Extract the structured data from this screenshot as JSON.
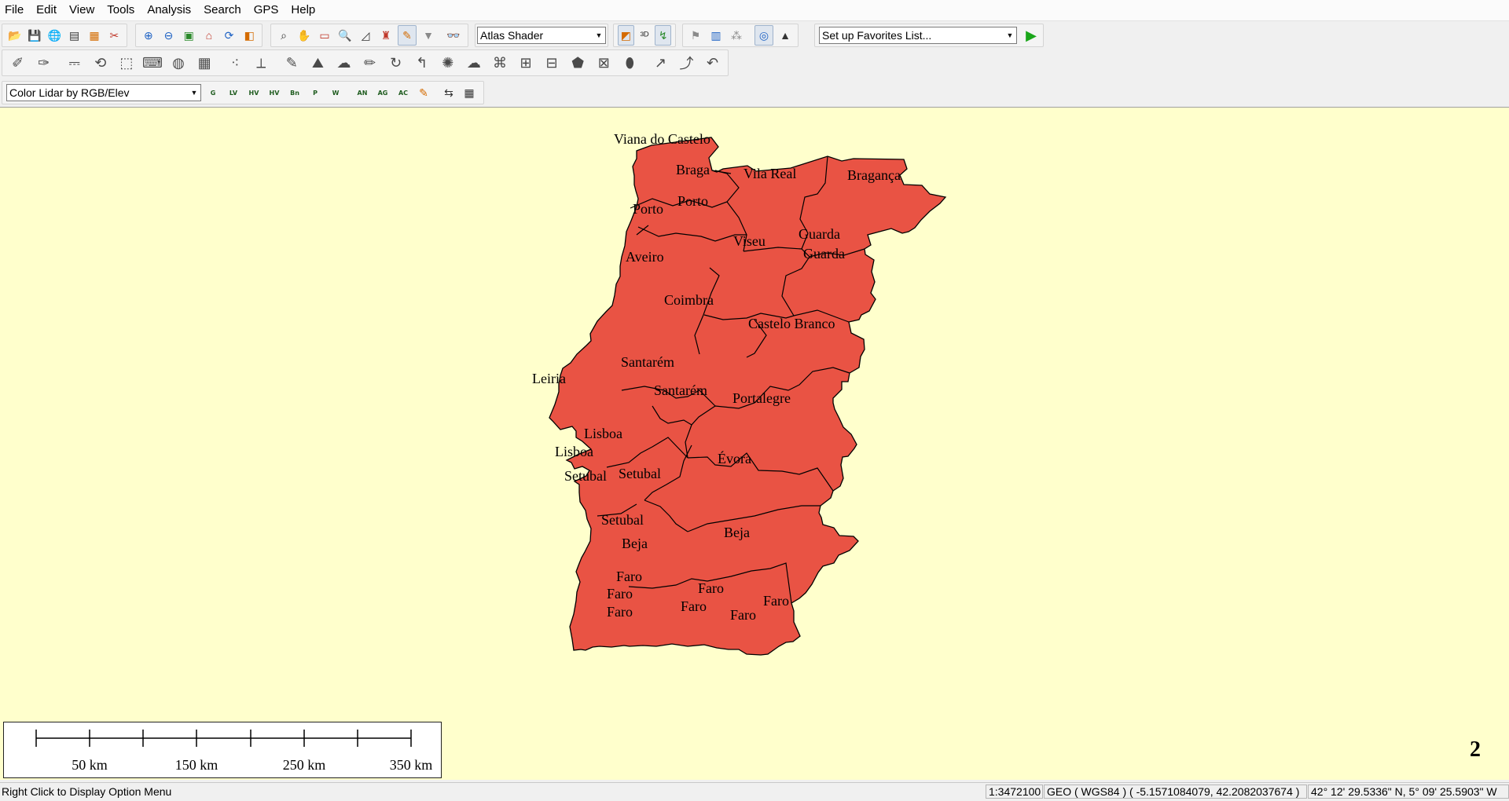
{
  "menu": [
    "File",
    "Edit",
    "View",
    "Tools",
    "Analysis",
    "Search",
    "GPS",
    "Help"
  ],
  "toolbar": {
    "shader_select": "Atlas Shader",
    "favorites_select": "Set up Favorites List...",
    "lidar_select": "Color Lidar by RGB/Elev",
    "tiny_buttons": [
      "G",
      "LV",
      "HV",
      "HV",
      "Bn",
      "P",
      "W",
      "AN",
      "AG",
      "AC"
    ]
  },
  "map": {
    "labels": {
      "viana": "Viana do Castelo",
      "braga": "Braga",
      "vila_real": "Vila Real",
      "braganca": "Bragança",
      "porto1": "Porto",
      "porto2": "Porto",
      "viseu": "Viseu",
      "guarda1": "Guarda",
      "guarda2": "Guarda",
      "aveiro": "Aveiro",
      "coimbra": "Coimbra",
      "castelo_branco": "Castelo Branco",
      "santarem1": "Santarém",
      "leiria": "Leiria",
      "santarem2": "Santarém",
      "portalegre": "Portalegre",
      "lisboa1": "Lisboa",
      "lisboa2": "Lisboa",
      "evora": "Évora",
      "setubal1": "Setubal",
      "setubal2": "Setubal",
      "setubal3": "Setubal",
      "beja1": "Beja",
      "beja2": "Beja",
      "faro1": "Faro",
      "faro2": "Faro",
      "faro3": "Faro",
      "faro4": "Faro",
      "faro5": "Faro",
      "faro6": "Faro",
      "faro7": "Faro"
    },
    "fill_color": "#e95344",
    "background_color": "#ffffcc",
    "page_number": "2"
  },
  "scalebar": {
    "labels": [
      "50 km",
      "150 km",
      "250 km",
      "350 km"
    ]
  },
  "status": {
    "message": "Right Click to Display Option Menu",
    "scale": "1:3472100",
    "projection": "GEO ( WGS84 ) ( -5.1571084079, 42.2082037674 )",
    "dms": "42° 12' 29.5336\" N, 5° 09' 25.5903\" W"
  }
}
